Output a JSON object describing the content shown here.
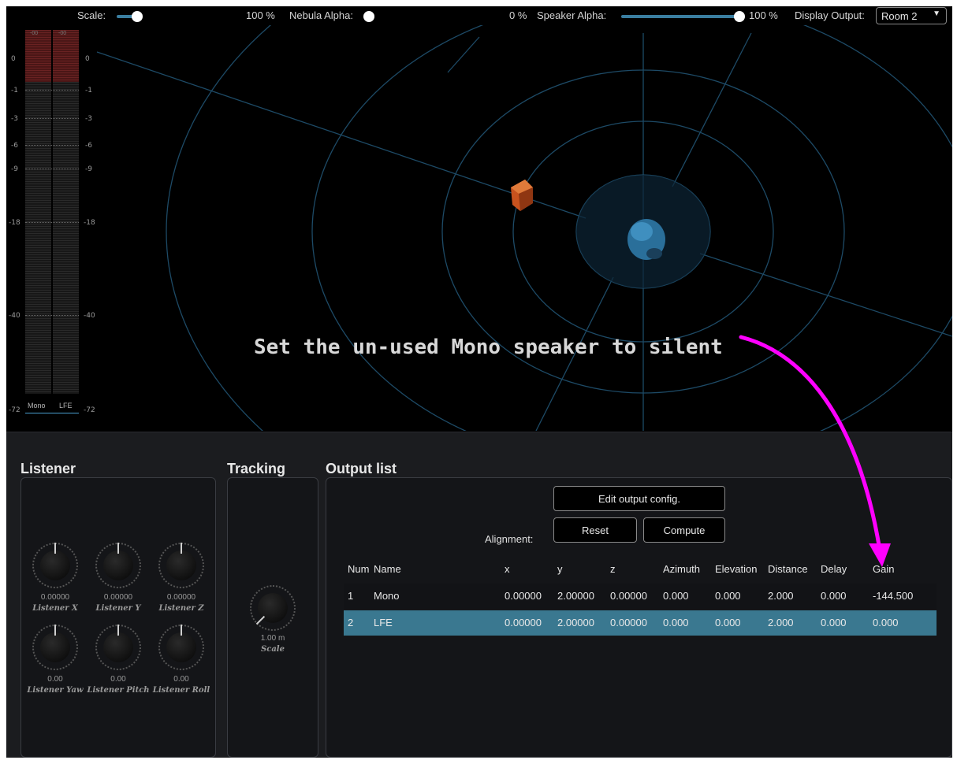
{
  "topbar": {
    "scale_label": "Scale:",
    "scale_value": "100 %",
    "nebula_label": "Nebula Alpha:",
    "nebula_value": "0 %",
    "speaker_label": "Speaker Alpha:",
    "speaker_value": "100 %",
    "display_label": "Display Output:",
    "display_value": "Room 2",
    "dropdown_arrow": "▼"
  },
  "meter": {
    "scale": [
      "0",
      "-1",
      "-3",
      "-6",
      "-9",
      "-18",
      "-40",
      "-72"
    ],
    "top_labels": [
      "-00",
      "-00"
    ],
    "channels": [
      "Mono",
      "LFE"
    ]
  },
  "viewport": {
    "annotation": "Set the un-used Mono speaker to silent"
  },
  "listener": {
    "title": "Listener",
    "knobs": [
      {
        "value": "0.00000",
        "label": "Listener X"
      },
      {
        "value": "0.00000",
        "label": "Listener Y"
      },
      {
        "value": "0.00000",
        "label": "Listener Z"
      },
      {
        "value": "0.00",
        "label": "Listener Yaw"
      },
      {
        "value": "0.00",
        "label": "Listener Pitch"
      },
      {
        "value": "0.00",
        "label": "Listener Roll"
      }
    ]
  },
  "tracking": {
    "title": "Tracking",
    "knob": {
      "value": "1.00 m",
      "label": "Scale"
    }
  },
  "output": {
    "title": "Output list",
    "edit_button": "Edit output config.",
    "alignment_label": "Alignment:",
    "reset_button": "Reset",
    "compute_button": "Compute",
    "columns": [
      "Num",
      "Name",
      "x",
      "y",
      "z",
      "Azimuth",
      "Elevation",
      "Distance",
      "Delay",
      "Gain"
    ],
    "rows": [
      [
        "1",
        "Mono",
        "0.00000",
        "2.00000",
        "0.00000",
        "0.000",
        "0.000",
        "2.000",
        "0.000",
        "-144.500"
      ],
      [
        "2",
        "LFE",
        "0.00000",
        "2.00000",
        "0.00000",
        "0.000",
        "0.000",
        "2.000",
        "0.000",
        "0.000"
      ]
    ]
  },
  "colors": {
    "accent": "#3a7890",
    "annotation_arrow": "#ff00ff",
    "speaker": "#c8521e"
  }
}
